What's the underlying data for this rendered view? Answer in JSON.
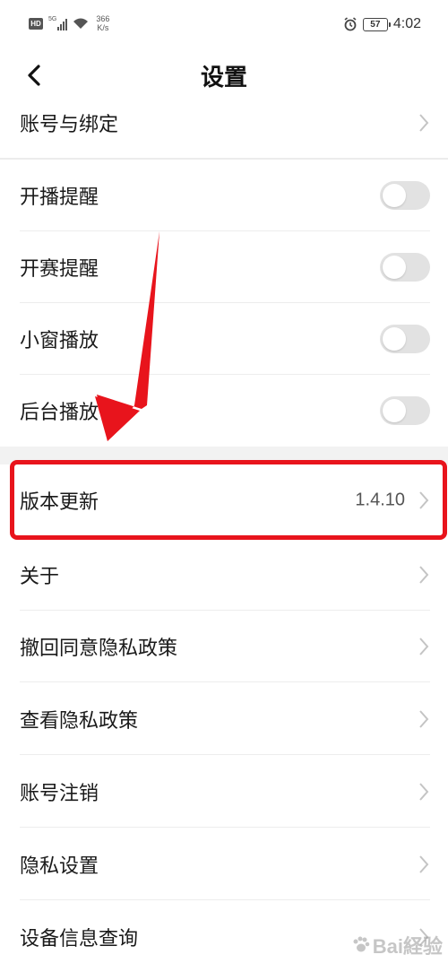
{
  "status_bar": {
    "hd": "HD",
    "network": "5G",
    "speed_value": "366",
    "speed_unit": "K/s",
    "battery": "57",
    "time": "4:02"
  },
  "nav": {
    "title": "设置"
  },
  "settings": {
    "account_binding": {
      "label": "账号与绑定"
    },
    "stream_reminder": {
      "label": "开播提醒",
      "enabled": false
    },
    "match_reminder": {
      "label": "开赛提醒",
      "enabled": false
    },
    "mini_window": {
      "label": "小窗播放",
      "enabled": false
    },
    "background_play": {
      "label": "后台播放",
      "enabled": false
    },
    "version_update": {
      "label": "版本更新",
      "value": "1.4.10"
    },
    "about": {
      "label": "关于"
    },
    "revoke_privacy": {
      "label": "撤回同意隐私政策"
    },
    "view_privacy": {
      "label": "查看隐私政策"
    },
    "account_cancel": {
      "label": "账号注销"
    },
    "privacy_settings": {
      "label": "隐私设置"
    },
    "device_info": {
      "label": "设备信息查询"
    }
  },
  "watermark": {
    "text": "Bai経验"
  },
  "colors": {
    "annotation_red": "#e8141c",
    "toggle_off": "#e2e2e2",
    "section_gap": "#f2f2f2"
  }
}
